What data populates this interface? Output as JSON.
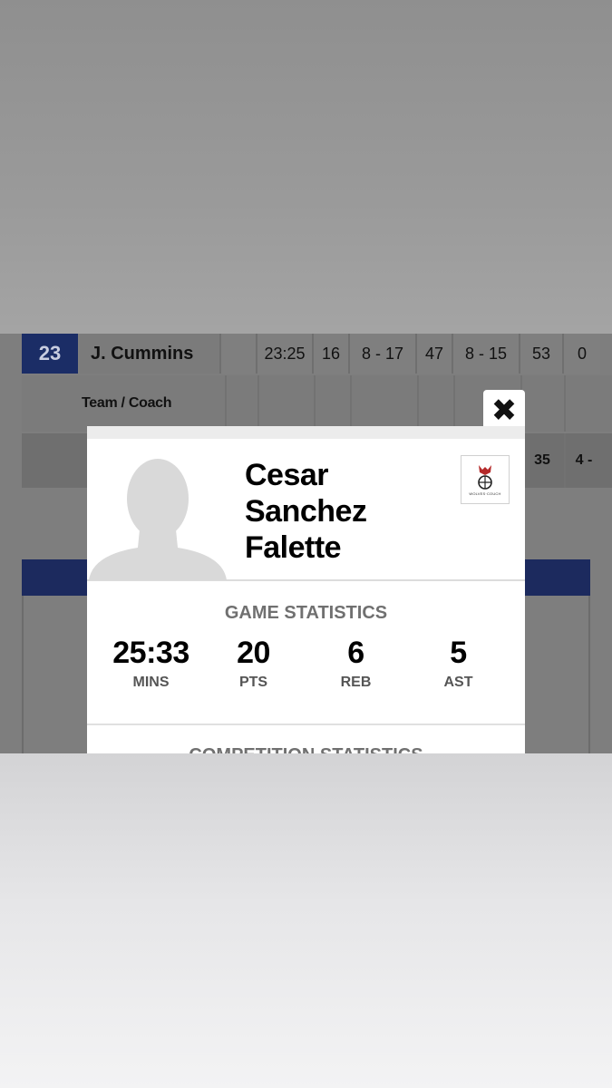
{
  "table": {
    "player_row": {
      "number": "23",
      "name": "J. Cummins",
      "cells": [
        "23:25",
        "16",
        "8 - 17",
        "47",
        "8 - 15",
        "53",
        "0"
      ]
    },
    "team_row": {
      "label": "Team / Coach"
    },
    "totals_row": {
      "cells": [
        "35",
        "4 -"
      ]
    }
  },
  "modal": {
    "close_icon": "close-icon",
    "player_name_lines": [
      "Cesar",
      "Sanchez",
      "Falette"
    ],
    "team_logo_text": "WOLVES·COUCH",
    "game_stats_title": "GAME STATISTICS",
    "stats": [
      {
        "value": "25:33",
        "label": "MINS"
      },
      {
        "value": "20",
        "label": "PTS"
      },
      {
        "value": "6",
        "label": "REB"
      },
      {
        "value": "5",
        "label": "AST"
      }
    ],
    "competition_stats_title": "COMPETITION STATISTICS"
  },
  "colors": {
    "navy": "#1c2a5e",
    "overlay_gray": "#7e7e7e"
  }
}
